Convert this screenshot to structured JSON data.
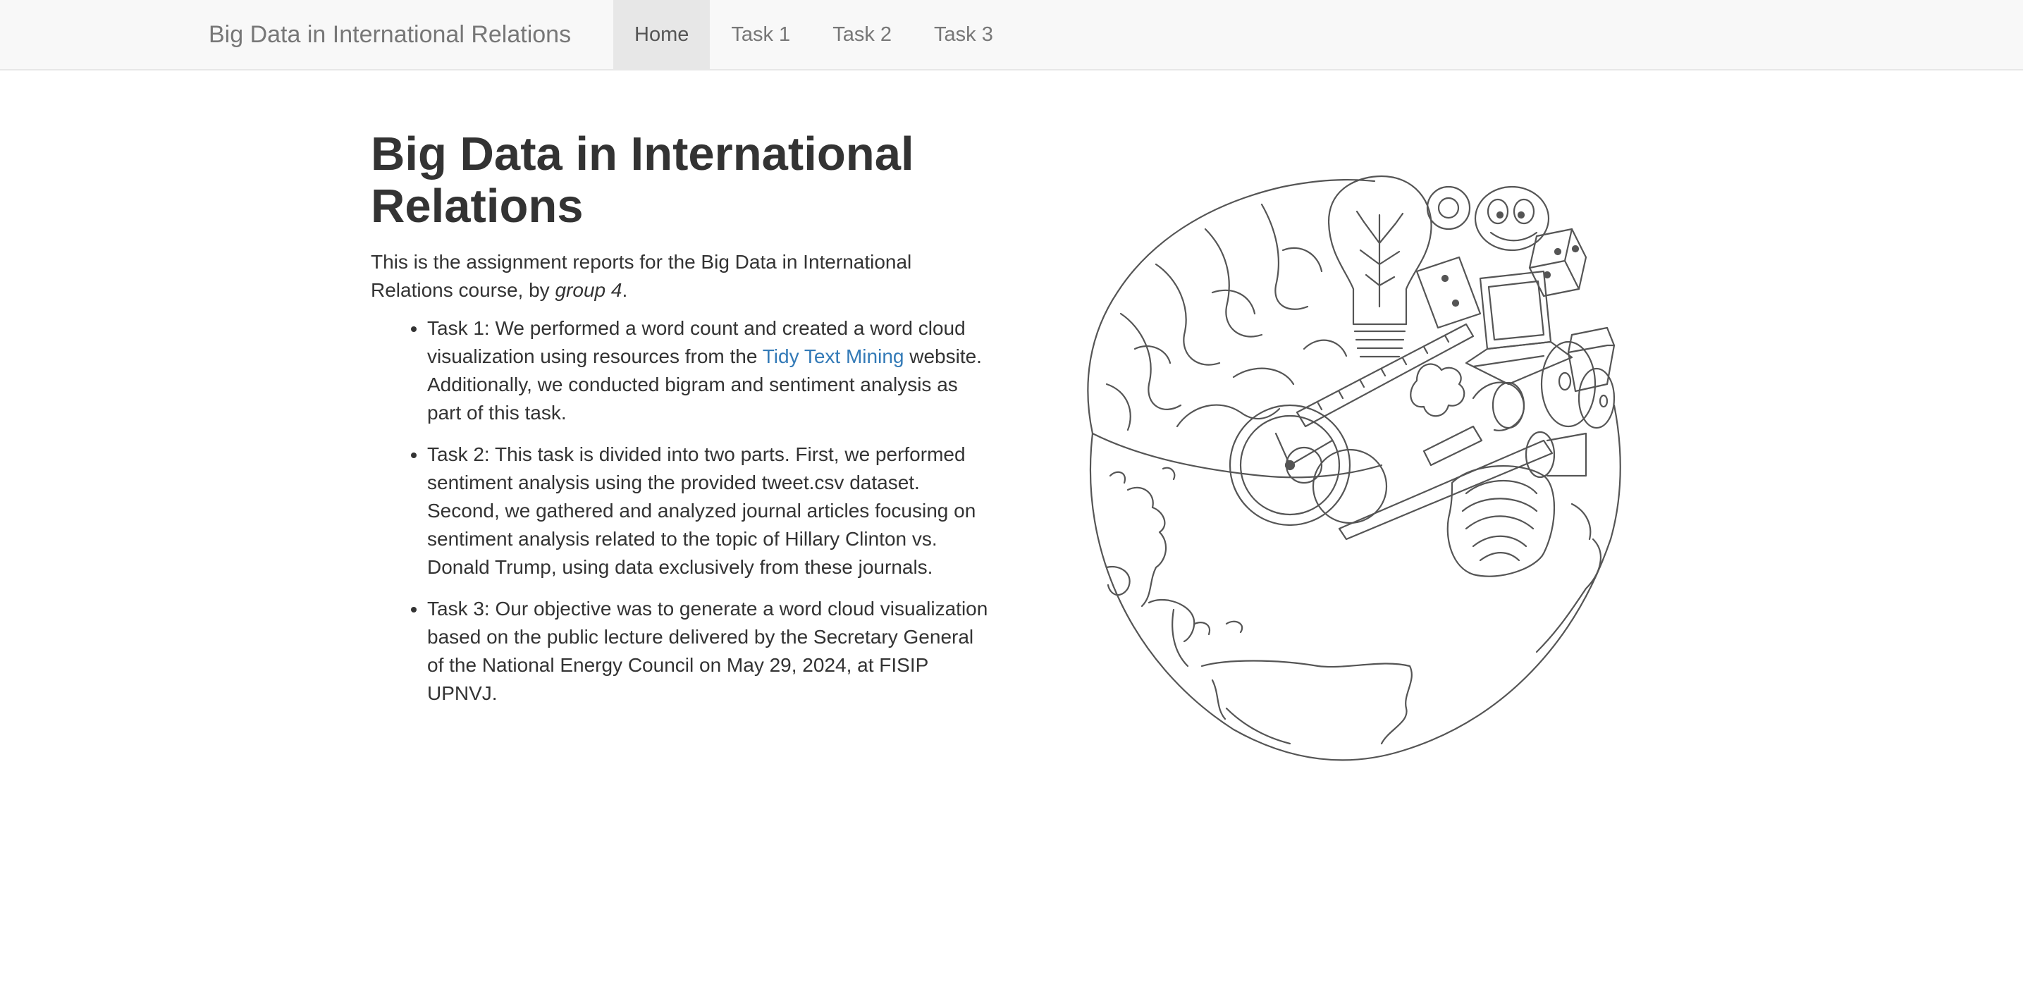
{
  "navbar": {
    "brand": "Big Data in International Relations",
    "items": [
      {
        "label": "Home",
        "active": true
      },
      {
        "label": "Task 1",
        "active": false
      },
      {
        "label": "Task 2",
        "active": false
      },
      {
        "label": "Task 3",
        "active": false
      }
    ]
  },
  "main": {
    "title": "Big Data in International Relations",
    "intro_prefix": "This is the assignment reports for the Big Data in International Relations course, by ",
    "intro_group": "group 4",
    "intro_suffix": ".",
    "tasks": [
      {
        "before": "Task 1: We performed a word count and created a word cloud visualization using resources from the ",
        "link": "Tidy Text Mining",
        "after": " website. Additionally, we conducted bigram and sentiment analysis as part of this task."
      },
      {
        "text": "Task 2: This task is divided into two parts. First, we performed sentiment analysis using the provided tweet.csv dataset. Second, we gathered and analyzed journal articles focusing on sentiment analysis related to the topic of Hillary Clinton vs. Donald Trump, using data exclusively from these journals."
      },
      {
        "text": "Task 3: Our objective was to generate a word cloud visualization based on the public lecture delivered by the Secretary General of the National Energy Council on May 29, 2024, at FISIP UPNVJ."
      }
    ],
    "illustration": {
      "icon": "globe-brain-sketch-illustration",
      "line_color": "#555555"
    }
  },
  "colors": {
    "navbar_bg": "#f8f8f8",
    "navbar_active_bg": "#e7e7e7",
    "text": "#333333",
    "link": "#337ab7"
  }
}
